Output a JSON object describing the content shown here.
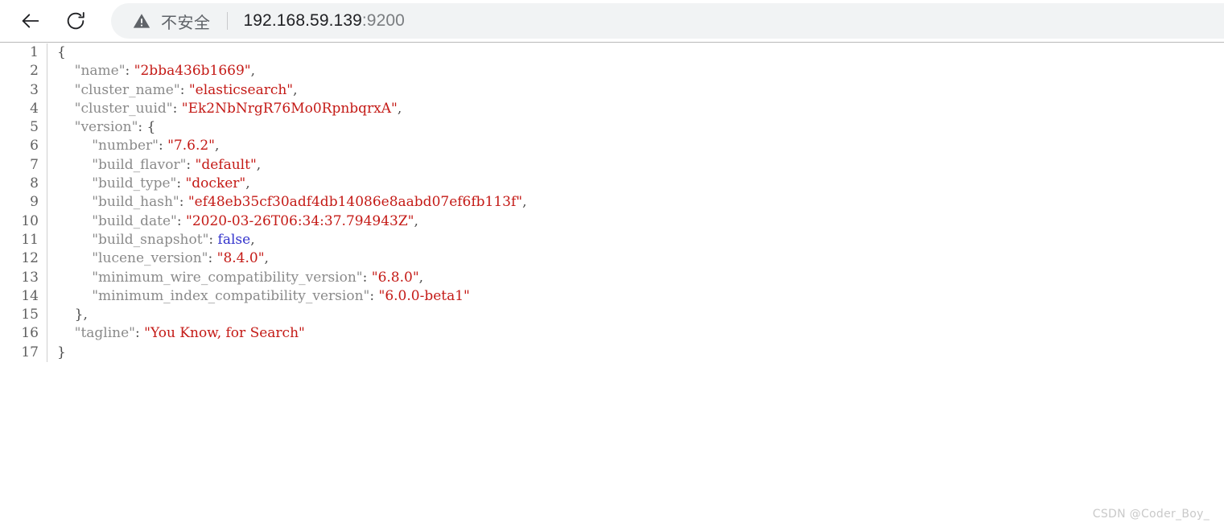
{
  "browser": {
    "back_label": "Back",
    "reload_label": "Reload",
    "security": {
      "icon": "warning-triangle-icon",
      "label": "不安全"
    },
    "url": {
      "host": "192.168.59.139",
      "port": ":9200",
      "full": "192.168.59.139:9200"
    }
  },
  "json_document": {
    "line_numbers": [
      "1",
      "2",
      "3",
      "4",
      "5",
      "6",
      "7",
      "8",
      "9",
      "10",
      "11",
      "12",
      "13",
      "14",
      "15",
      "16",
      "17"
    ],
    "lines": [
      {
        "indent": 0,
        "tokens": [
          {
            "t": "punct",
            "v": "{"
          }
        ]
      },
      {
        "indent": 1,
        "tokens": [
          {
            "t": "key",
            "v": "\"name\""
          },
          {
            "t": "punct",
            "v": ": "
          },
          {
            "t": "str",
            "v": "\"2bba436b1669\""
          },
          {
            "t": "punct",
            "v": ","
          }
        ]
      },
      {
        "indent": 1,
        "tokens": [
          {
            "t": "key",
            "v": "\"cluster_name\""
          },
          {
            "t": "punct",
            "v": ": "
          },
          {
            "t": "str",
            "v": "\"elasticsearch\""
          },
          {
            "t": "punct",
            "v": ","
          }
        ]
      },
      {
        "indent": 1,
        "tokens": [
          {
            "t": "key",
            "v": "\"cluster_uuid\""
          },
          {
            "t": "punct",
            "v": ": "
          },
          {
            "t": "str",
            "v": "\"Ek2NbNrgR76Mo0RpnbqrxA\""
          },
          {
            "t": "punct",
            "v": ","
          }
        ]
      },
      {
        "indent": 1,
        "tokens": [
          {
            "t": "key",
            "v": "\"version\""
          },
          {
            "t": "punct",
            "v": ": {"
          }
        ]
      },
      {
        "indent": 2,
        "tokens": [
          {
            "t": "key",
            "v": "\"number\""
          },
          {
            "t": "punct",
            "v": ": "
          },
          {
            "t": "str",
            "v": "\"7.6.2\""
          },
          {
            "t": "punct",
            "v": ","
          }
        ]
      },
      {
        "indent": 2,
        "tokens": [
          {
            "t": "key",
            "v": "\"build_flavor\""
          },
          {
            "t": "punct",
            "v": ": "
          },
          {
            "t": "str",
            "v": "\"default\""
          },
          {
            "t": "punct",
            "v": ","
          }
        ]
      },
      {
        "indent": 2,
        "tokens": [
          {
            "t": "key",
            "v": "\"build_type\""
          },
          {
            "t": "punct",
            "v": ": "
          },
          {
            "t": "str",
            "v": "\"docker\""
          },
          {
            "t": "punct",
            "v": ","
          }
        ]
      },
      {
        "indent": 2,
        "tokens": [
          {
            "t": "key",
            "v": "\"build_hash\""
          },
          {
            "t": "punct",
            "v": ": "
          },
          {
            "t": "str",
            "v": "\"ef48eb35cf30adf4db14086e8aabd07ef6fb113f\""
          },
          {
            "t": "punct",
            "v": ","
          }
        ]
      },
      {
        "indent": 2,
        "tokens": [
          {
            "t": "key",
            "v": "\"build_date\""
          },
          {
            "t": "punct",
            "v": ": "
          },
          {
            "t": "str",
            "v": "\"2020-03-26T06:34:37.794943Z\""
          },
          {
            "t": "punct",
            "v": ","
          }
        ]
      },
      {
        "indent": 2,
        "tokens": [
          {
            "t": "key",
            "v": "\"build_snapshot\""
          },
          {
            "t": "punct",
            "v": ": "
          },
          {
            "t": "bool",
            "v": "false"
          },
          {
            "t": "punct",
            "v": ","
          }
        ]
      },
      {
        "indent": 2,
        "tokens": [
          {
            "t": "key",
            "v": "\"lucene_version\""
          },
          {
            "t": "punct",
            "v": ": "
          },
          {
            "t": "str",
            "v": "\"8.4.0\""
          },
          {
            "t": "punct",
            "v": ","
          }
        ]
      },
      {
        "indent": 2,
        "tokens": [
          {
            "t": "key",
            "v": "\"minimum_wire_compatibility_version\""
          },
          {
            "t": "punct",
            "v": ": "
          },
          {
            "t": "str",
            "v": "\"6.8.0\""
          },
          {
            "t": "punct",
            "v": ","
          }
        ]
      },
      {
        "indent": 2,
        "tokens": [
          {
            "t": "key",
            "v": "\"minimum_index_compatibility_version\""
          },
          {
            "t": "punct",
            "v": ": "
          },
          {
            "t": "str",
            "v": "\"6.0.0-beta1\""
          }
        ]
      },
      {
        "indent": 1,
        "tokens": [
          {
            "t": "punct",
            "v": "},"
          }
        ]
      },
      {
        "indent": 1,
        "tokens": [
          {
            "t": "key",
            "v": "\"tagline\""
          },
          {
            "t": "punct",
            "v": ": "
          },
          {
            "t": "str",
            "v": "\"You Know, for Search\""
          }
        ]
      },
      {
        "indent": 0,
        "tokens": [
          {
            "t": "punct",
            "v": "}"
          }
        ]
      }
    ]
  },
  "watermark": {
    "text": "CSDN @Coder_Boy_"
  }
}
